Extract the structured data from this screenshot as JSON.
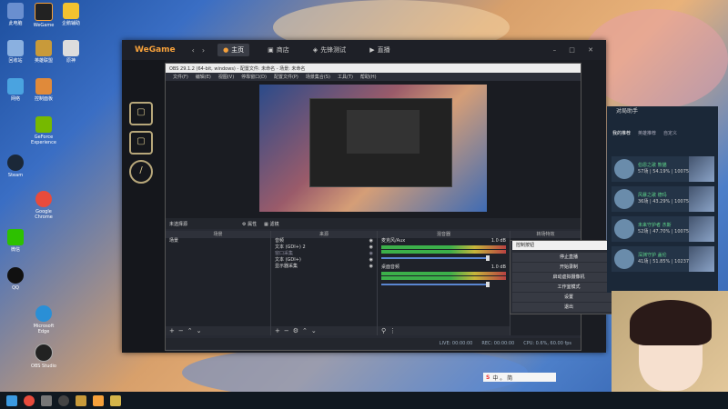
{
  "desktop": {
    "icons": [
      {
        "label": "此电脑",
        "name": "this-pc-icon"
      },
      {
        "label": "WeGame",
        "name": "wegame-icon"
      },
      {
        "label": "企鹅辅助",
        "name": "penguin-helper-icon"
      },
      {
        "label": "回收站",
        "name": "recycle-bin-icon"
      },
      {
        "label": "英雄联盟",
        "name": "lol-icon"
      },
      {
        "label": "原神",
        "name": "genshin-icon"
      },
      {
        "label": "网络",
        "name": "network-icon"
      },
      {
        "label": "控制面板",
        "name": "control-panel-icon"
      },
      {
        "label": "Google Chrome",
        "name": "chrome-icon"
      },
      {
        "label": "GeForce Experience",
        "name": "geforce-icon"
      },
      {
        "label": "Steam",
        "name": "steam-icon"
      },
      {
        "label": "微信",
        "name": "wechat-icon"
      },
      {
        "label": "QQ",
        "name": "qq-icon"
      },
      {
        "label": "Microsoft Edge",
        "name": "edge-icon"
      },
      {
        "label": "OBS Studio",
        "name": "obs-icon"
      }
    ]
  },
  "wegame": {
    "logo": "WeGame",
    "tabs": [
      {
        "label": "主页"
      },
      {
        "label": "商店"
      },
      {
        "label": "先锋测试"
      },
      {
        "label": "直播"
      }
    ]
  },
  "obs": {
    "title": "OBS 29.1.2 (64-bit, windows) - 配置文件: 未命名 - 场景: 未命名",
    "menu": [
      "文件(F)",
      "编辑(E)",
      "视图(V)",
      "停靠窗口(D)",
      "配置文件(P)",
      "场景集合(S)",
      "工具(T)",
      "帮助(H)"
    ],
    "no_source": "未选择源",
    "properties_btn": "属性",
    "filters_btn": "滤镜",
    "docks": {
      "scenes": "场景",
      "sources": "来源",
      "mixer": "混音器",
      "transitions": "转场特效",
      "controls": "控制按钮"
    },
    "scenes": [
      "场景"
    ],
    "sources": [
      "音频",
      "文本 (GDI+) 2",
      "窗口采集",
      "文本 (GDI+)",
      "显示器采集"
    ],
    "mixer": [
      {
        "name": "麦克风/Aux",
        "level": "1.0 dB"
      },
      {
        "name": "桌面音频",
        "level": "1.0 dB"
      }
    ],
    "status": {
      "live": "LIVE: 00:00:00",
      "rec": "REC: 00:00:00",
      "cpu": "CPU: 0.6%, 60.00 fps"
    }
  },
  "context_menu": {
    "title": "控制按钮",
    "items": [
      "停止直播",
      "开始录制",
      "启动虚拟摄像机",
      "工作室模式",
      "设置",
      "退出"
    ]
  },
  "right_panel": {
    "title": "对局助手",
    "tabs": [
      "我的推荐",
      "英雄推荐",
      "自定义"
    ],
    "cards": [
      {
        "name": "伯恩之歌 熊猫",
        "stat": "57场 | 54.19% | 10075"
      },
      {
        "name": "风暴之歌 德玛",
        "stat": "36场 | 43.29% | 10075"
      },
      {
        "name": "未来守护者 杰斯",
        "stat": "52场 | 47.70% | 10075"
      },
      {
        "name": "深渊守护 盖伦",
        "stat": "41场 | 51.85% | 10237"
      }
    ]
  },
  "ime": {
    "text": "中 。 简"
  }
}
